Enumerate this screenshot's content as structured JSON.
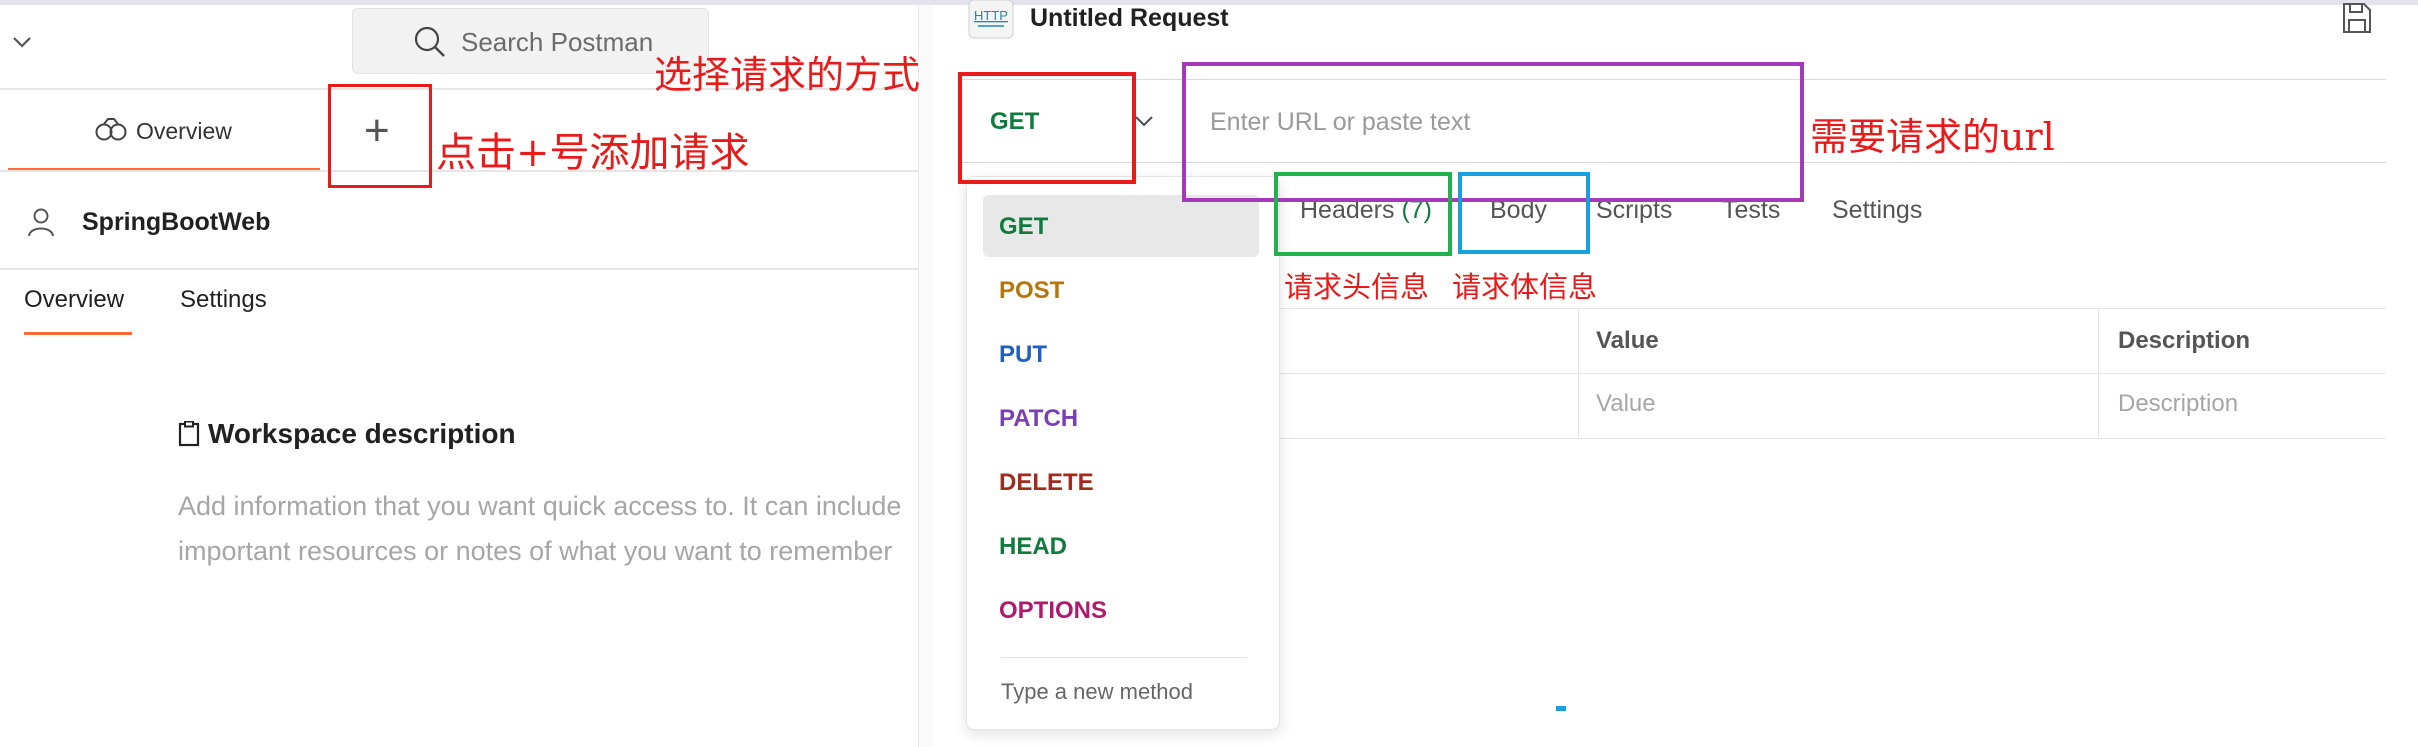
{
  "left": {
    "search_placeholder": "Search Postman",
    "overview_tab": "Overview",
    "workspace_name": "SpringBootWeb",
    "subtabs": [
      "Overview",
      "Settings"
    ],
    "description_title": "Workspace description",
    "description_lines": [
      "Add information that you want quick access to. It can include",
      "important resources or notes of what you want to remember"
    ]
  },
  "request": {
    "title": "Untitled Request",
    "method": "GET",
    "url_placeholder": "Enter URL or paste text",
    "tabs": [
      {
        "label": "Headers",
        "count": "(7)"
      },
      {
        "label": "Body"
      },
      {
        "label": "Scripts"
      },
      {
        "label": "Tests"
      },
      {
        "label": "Settings"
      }
    ],
    "table": {
      "headers": [
        "Value",
        "Description"
      ],
      "placeholders": [
        "Value",
        "Description"
      ]
    }
  },
  "method_dropdown": {
    "options": [
      {
        "label": "GET",
        "color": "#0f7b3d"
      },
      {
        "label": "POST",
        "color": "#b5760b"
      },
      {
        "label": "PUT",
        "color": "#1f5fc1"
      },
      {
        "label": "PATCH",
        "color": "#7a3fb5"
      },
      {
        "label": "DELETE",
        "color": "#a12b1e"
      },
      {
        "label": "HEAD",
        "color": "#0f7b3d"
      },
      {
        "label": "OPTIONS",
        "color": "#b0196e"
      }
    ],
    "new_method": "Type a new method"
  },
  "annotations": {
    "add_request": "点击+号添加请求",
    "choose_method": "选择请求的方式",
    "url_needed": "需要请求的url",
    "headers_info": "请求头信息",
    "body_info": "请求体信息",
    "colors": {
      "red": "#e81a1a",
      "purple": "#a43ab8",
      "green": "#22b14c",
      "blue": "#1aa0e0"
    }
  }
}
